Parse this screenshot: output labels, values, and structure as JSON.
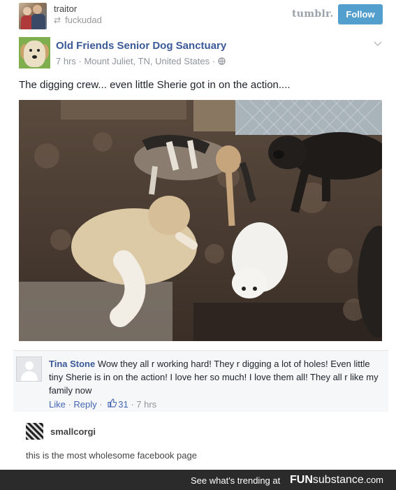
{
  "tumblr": {
    "username": "traitor",
    "reblogged_from": "fuckudad",
    "logo": "tumblr.",
    "follow_label": "Follow",
    "follow_color": "#529ecc"
  },
  "facebook_post": {
    "page_name": "Old Friends Senior Dog Sanctuary",
    "meta": "7 hrs · Mount Juliet, TN, United States · ",
    "text": "The digging crew... even little Sherie got in on the action....",
    "link_color": "#3b5998"
  },
  "comment": {
    "author": "Tina Stone",
    "text": "Wow they all r working hard! They r digging a lot of holes! Even little tiny Sherie is in on the action! I love her so much! I love them all! They all r like my family now",
    "like_label": "Like",
    "reply_label": "Reply",
    "separator": " · ",
    "like_count": "31",
    "time": "7 hrs"
  },
  "reblog": {
    "username": "smallcorgi",
    "text": "this is the most wholesome facebook page"
  },
  "footer": {
    "trending_text": "See what's trending at",
    "brand_fun": "FUN",
    "brand_rest": "substance",
    "brand_suffix": ".com"
  }
}
